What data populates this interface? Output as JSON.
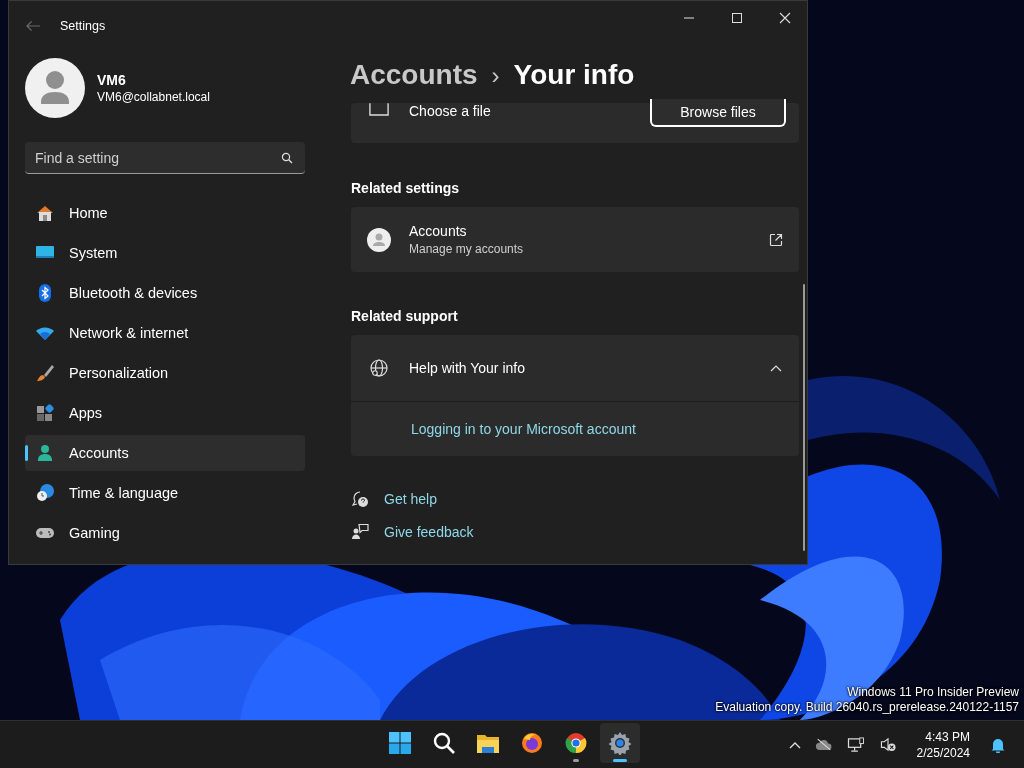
{
  "window": {
    "title": "Settings"
  },
  "profile": {
    "name": "VM6",
    "email": "VM6@collabnet.local"
  },
  "search": {
    "placeholder": "Find a setting"
  },
  "nav": [
    {
      "label": "Home",
      "kind": "home",
      "selected": false
    },
    {
      "label": "System",
      "kind": "system",
      "selected": false
    },
    {
      "label": "Bluetooth & devices",
      "kind": "bluetooth",
      "selected": false
    },
    {
      "label": "Network & internet",
      "kind": "network",
      "selected": false
    },
    {
      "label": "Personalization",
      "kind": "brush",
      "selected": false
    },
    {
      "label": "Apps",
      "kind": "apps",
      "selected": false
    },
    {
      "label": "Accounts",
      "kind": "accounts",
      "selected": true
    },
    {
      "label": "Time & language",
      "kind": "time",
      "selected": false
    },
    {
      "label": "Gaming",
      "kind": "gaming",
      "selected": false
    }
  ],
  "breadcrumb": {
    "parent": "Accounts",
    "separator": "›",
    "current": "Your info"
  },
  "file_row": {
    "label": "Choose a file",
    "button": "Browse files"
  },
  "related_settings": {
    "heading": "Related settings",
    "items": [
      {
        "title": "Accounts",
        "subtitle": "Manage my accounts"
      }
    ]
  },
  "related_support": {
    "heading": "Related support",
    "items": [
      {
        "title": "Help with Your info",
        "expanded": true,
        "links": [
          "Logging in to your Microsoft account"
        ]
      }
    ]
  },
  "footer_links": [
    {
      "label": "Get help",
      "kind": "help"
    },
    {
      "label": "Give feedback",
      "kind": "feedback"
    }
  ],
  "desktop_notice": [
    "Windows 11 Pro Insider Preview",
    "Evaluation copy. Build 26040.rs_prerelease.240122-1157"
  ],
  "taskbar": {
    "apps": [
      {
        "kind": "start",
        "running": false,
        "selected": false
      },
      {
        "kind": "search",
        "running": false,
        "selected": false
      },
      {
        "kind": "explorer",
        "running": false,
        "selected": false
      },
      {
        "kind": "firefox",
        "running": false,
        "selected": false
      },
      {
        "kind": "chrome",
        "running": true,
        "selected": false
      },
      {
        "kind": "settings",
        "running": true,
        "selected": true
      }
    ],
    "clock": {
      "time": "4:43 PM",
      "date": "2/25/2024"
    }
  }
}
